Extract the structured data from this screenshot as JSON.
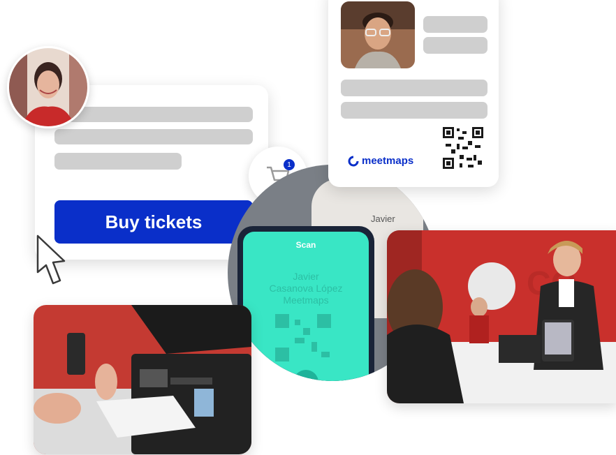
{
  "ticket_card": {
    "buy_button_label": "Buy tickets"
  },
  "cart": {
    "badge_count": "1",
    "icon": "shopping-cart-icon"
  },
  "badge_card": {
    "brand_name": "meetmaps",
    "icon": "meetmaps-logo-icon"
  },
  "phone": {
    "scan_label": "Scan",
    "attendee_name_line1": "Javier",
    "attendee_name_line2": "Casanova López",
    "attendee_name_line3": "Meetmaps",
    "lanyard_name": "Javier"
  },
  "colors": {
    "brand_blue": "#0a2fc9",
    "placeholder_gray": "#cfcfcf",
    "scan_green": "#39e6c5",
    "event_red": "#d0312d"
  }
}
